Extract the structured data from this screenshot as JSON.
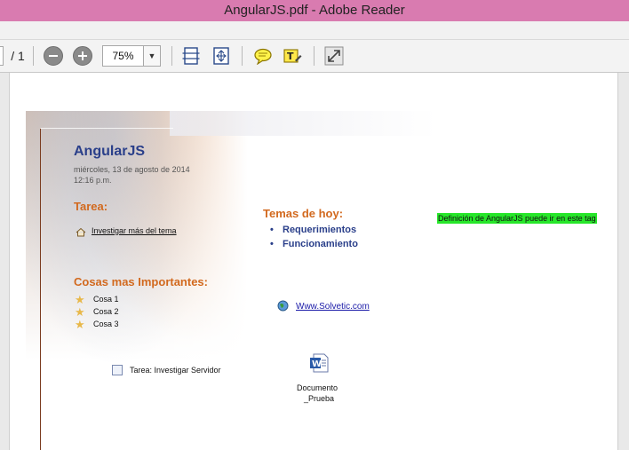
{
  "window": {
    "title": "AngularJS.pdf - Adobe Reader"
  },
  "toolbar": {
    "page_total": "/ 1",
    "zoom_value": "75%"
  },
  "note": {
    "title": "AngularJS",
    "date": "miércoles, 13 de agosto de 2014",
    "time": "12:16 p.m.",
    "tarea_heading": "Tarea:",
    "tarea_item": " Investigar más del tema",
    "temas_heading": "Temas de hoy:",
    "temas_items": [
      "Requerimientos",
      "Funcionamiento"
    ],
    "green_tag": "Definición de AngularJS puede ir en este tag",
    "cosas_heading": "Cosas mas Importantes:",
    "cosas_items": [
      "Cosa 1",
      "Cosa 2",
      "Cosa 3"
    ],
    "link": "Www.Solvetic.com",
    "task_checkbox": "Tarea: Investigar Servidor",
    "attachment_name_1": "Documento",
    "attachment_name_2": "_Prueba"
  }
}
